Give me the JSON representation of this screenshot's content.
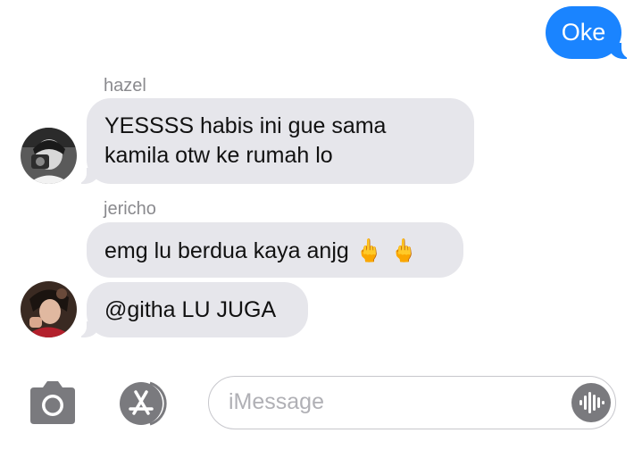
{
  "messages": {
    "outgoing": {
      "text": "Oke"
    },
    "hazel": {
      "sender": "hazel",
      "line1": "YESSSS habis ini gue sama",
      "line2": "kamila otw ke rumah lo"
    },
    "jericho": {
      "sender": "jericho",
      "message1": "emg lu berdua kaya anjg",
      "emoji": "🖕 🖕",
      "message2": "@githa LU JUGA"
    }
  },
  "compose": {
    "placeholder": "iMessage"
  },
  "icons": {
    "camera": "camera-icon",
    "app_store": "app-store-icon",
    "audio": "audio-waveform-icon"
  },
  "colors": {
    "accent": "#1a84ff",
    "incoming_bubble": "#e6e6eb",
    "icon_gray": "#7a7a7e"
  }
}
